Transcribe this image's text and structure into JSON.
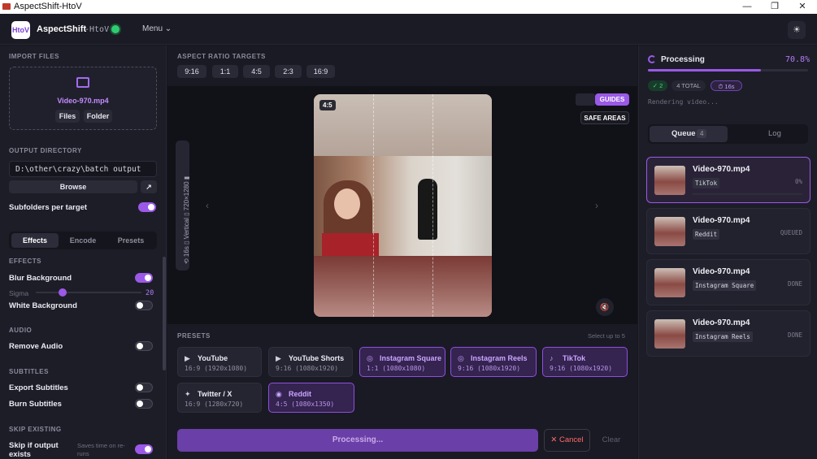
{
  "window": {
    "title": "AspectShift-HtoV",
    "min": "—",
    "max": "❐",
    "close": "✕"
  },
  "header": {
    "logo": "HtoV",
    "brand": "AspectShift",
    "brand_suffix": "-HtoV",
    "menu": "Menu ⌄",
    "theme_icon": "☀"
  },
  "left": {
    "import_title": "IMPORT FILES",
    "import_file": "Video-970.mp4",
    "files_btn": "Files",
    "folder_btn": "Folder",
    "output_title": "OUTPUT DIRECTORY",
    "output_path": "D:\\other\\crazy\\batch output",
    "browse_btn": "Browse",
    "open_icon": "↗",
    "subfolders_label": "Subfolders per target",
    "subfolders_on": true,
    "tabs": [
      "Effects",
      "Encode",
      "Presets"
    ],
    "effects_title": "EFFECTS",
    "blur_label": "Blur Background",
    "blur_on": true,
    "sigma_label": "Sigma",
    "sigma_value": "20",
    "white_label": "White Background",
    "white_on": false,
    "audio_title": "AUDIO",
    "remove_audio_label": "Remove Audio",
    "remove_audio_on": false,
    "subtitles_title": "SUBTITLES",
    "export_subs_label": "Export Subtitles",
    "burn_subs_label": "Burn Subtitles",
    "skip_title": "SKIP EXISTING",
    "skip_label": "Skip if output exists",
    "skip_hint": "Saves time on re-runs",
    "skip_on": true
  },
  "center": {
    "targets_title": "ASPECT RATIO TARGETS",
    "ratios": [
      "9:16",
      "1:1",
      "4:5",
      "2:3",
      "16:9"
    ],
    "preview_badge": "4:5",
    "guides_btn": "GUIDES",
    "safe_btn": "SAFE AREAS",
    "vertical_label": "⟲ 16s   ▯ Vertical   ▯ 720×1280   ▮",
    "mute_icon": "🔇",
    "presets_title": "PRESETS",
    "presets_hint": "Select up to 5",
    "presets": [
      {
        "name": "YouTube",
        "sub": "16:9 (1920x1080)",
        "icon": "▶",
        "sel": false
      },
      {
        "name": "YouTube Shorts",
        "sub": "9:16 (1080x1920)",
        "icon": "▶",
        "sel": false
      },
      {
        "name": "Instagram Square",
        "sub": "1:1 (1080x1080)",
        "icon": "◎",
        "sel": true
      },
      {
        "name": "Instagram Reels",
        "sub": "9:16 (1080x1920)",
        "icon": "◎",
        "sel": true
      },
      {
        "name": "TikTok",
        "sub": "9:16 (1080x1920)",
        "icon": "♪",
        "sel": true
      },
      {
        "name": "Twitter / X",
        "sub": "16:9 (1280x720)",
        "icon": "✦",
        "sel": false
      },
      {
        "name": "Reddit",
        "sub": "4:5 (1080x1350)",
        "icon": "◉",
        "sel": true
      }
    ],
    "process_btn": "Processing...",
    "cancel_btn": "✕ Cancel",
    "clear_btn": "Clear"
  },
  "right": {
    "status": "Processing",
    "percent": "70.8%",
    "progress": 0.708,
    "done_pill": "✓ 2",
    "total_pill": "4 TOTAL",
    "time_pill": "⏱ 16s",
    "rendering": "Rendering video...",
    "tab_queue": "Queue",
    "queue_count": "4",
    "tab_log": "Log",
    "queue": [
      {
        "name": "Video-970.mp4",
        "target": "TikTok",
        "status": "0%"
      },
      {
        "name": "Video-970.mp4",
        "target": "Reddit",
        "status": "QUEUED"
      },
      {
        "name": "Video-970.mp4",
        "target": "Instagram Square",
        "status": "DONE"
      },
      {
        "name": "Video-970.mp4",
        "target": "Instagram Reels",
        "status": "DONE"
      }
    ]
  },
  "colors": {
    "accent": "#9b59e8",
    "bg": "#16161f",
    "panel": "#1d1d28"
  }
}
